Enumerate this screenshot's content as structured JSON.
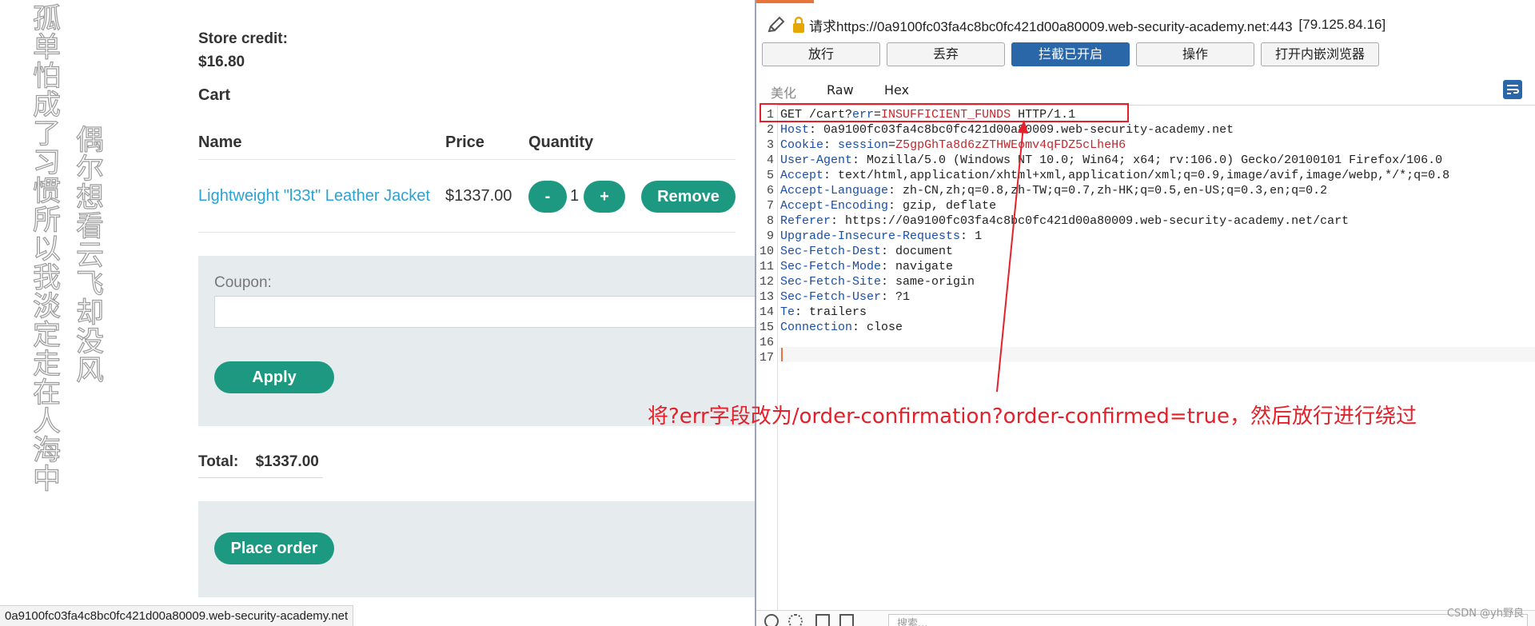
{
  "web": {
    "vertical_text_1": "孤单怕成了习惯所以我淡定走在人海中",
    "vertical_text_2": "偶尔想看云飞却没风",
    "store_credit_label": "Store credit:",
    "store_credit_value": "$16.80",
    "cart_title": "Cart",
    "table_headers": [
      "Name",
      "Price",
      "Quantity"
    ],
    "product": {
      "name": "Lightweight \"l33t\" Leather Jacket",
      "price": "$1337.00",
      "qty_minus": "-",
      "qty": "1",
      "qty_plus": "+",
      "remove": "Remove"
    },
    "coupon_label": "Coupon:",
    "apply_button": "Apply",
    "total_label": "Total:",
    "total_value": "$1337.00",
    "place_order_button": "Place order",
    "status_url": "0a9100fc03fa4c8bc0fc421d00a80009.web-security-academy.net"
  },
  "burp": {
    "request_url": "请求https://0a9100fc03fa4c8bc0fc421d00a80009.web-security-academy.net:443",
    "request_ip": "[79.125.84.16]",
    "toolbar": {
      "forward": "放行",
      "drop": "丢弃",
      "intercept": "拦截已开启",
      "action": "操作",
      "open_browser": "打开内嵌浏览器"
    },
    "tabs": {
      "pretty": "美化",
      "raw": "Raw",
      "hex": "Hex"
    },
    "lines": [
      {
        "n": "1",
        "method": "GET /cart?",
        "k": "err",
        "sep": "=",
        "v": "INSUFFICIENT_FUNDS",
        "rest": " HTTP/1.1"
      },
      {
        "n": "2",
        "k": "Host",
        "sep": ": ",
        "rest": "0a9100fc03fa4c8bc0fc421d00a80009.web-security-academy.net"
      },
      {
        "n": "3",
        "k": "Cookie",
        "sep": ": ",
        "k2": "session",
        "sep2": "=",
        "v": "Z5gpGhTa8d6zZTHWEomv4qFDZ5cLheH6"
      },
      {
        "n": "4",
        "k": "User-Agent",
        "sep": ": ",
        "rest": "Mozilla/5.0 (Windows NT 10.0; Win64; x64; rv:106.0) Gecko/20100101 Firefox/106.0"
      },
      {
        "n": "5",
        "k": "Accept",
        "sep": ": ",
        "rest": "text/html,application/xhtml+xml,application/xml;q=0.9,image/avif,image/webp,*/*;q=0.8"
      },
      {
        "n": "6",
        "k": "Accept-Language",
        "sep": ": ",
        "rest": "zh-CN,zh;q=0.8,zh-TW;q=0.7,zh-HK;q=0.5,en-US;q=0.3,en;q=0.2"
      },
      {
        "n": "7",
        "k": "Accept-Encoding",
        "sep": ": ",
        "rest": "gzip, deflate"
      },
      {
        "n": "8",
        "k": "Referer",
        "sep": ": ",
        "rest": "https://0a9100fc03fa4c8bc0fc421d00a80009.web-security-academy.net/cart"
      },
      {
        "n": "9",
        "k": "Upgrade-Insecure-Requests",
        "sep": ": ",
        "rest": "1"
      },
      {
        "n": "10",
        "k": "Sec-Fetch-Dest",
        "sep": ": ",
        "rest": "document"
      },
      {
        "n": "11",
        "k": "Sec-Fetch-Mode",
        "sep": ": ",
        "rest": "navigate"
      },
      {
        "n": "12",
        "k": "Sec-Fetch-Site",
        "sep": ": ",
        "rest": "same-origin"
      },
      {
        "n": "13",
        "k": "Sec-Fetch-User",
        "sep": ": ",
        "rest": "?1"
      },
      {
        "n": "14",
        "k": "Te",
        "sep": ": ",
        "rest": "trailers"
      },
      {
        "n": "15",
        "k": "Connection",
        "sep": ": ",
        "rest": "close"
      },
      {
        "n": "16"
      },
      {
        "n": "17"
      }
    ],
    "search_placeholder": "搜索..."
  },
  "annotation": "将?err字段改为/order-confirmation?order-confirmed=true，然后放行进行绕过",
  "watermark": "CSDN @yh野良",
  "colors": {
    "accent_green": "#1c9980",
    "link_blue": "#29a3d4",
    "burp_blue": "#2a67a8",
    "annotation_red": "#e5202a"
  }
}
